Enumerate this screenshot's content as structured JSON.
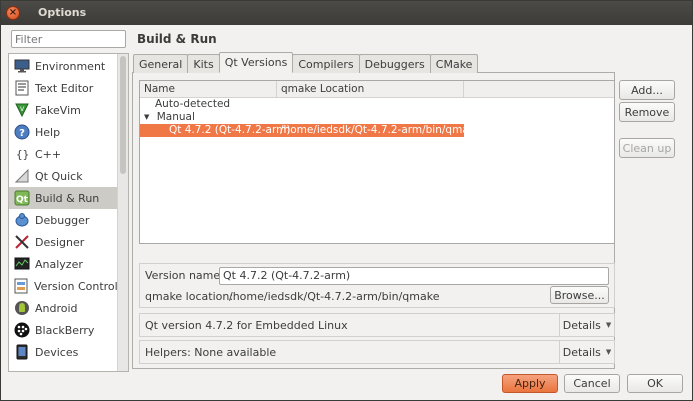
{
  "window": {
    "title": "Options",
    "close_glyph": "×"
  },
  "filter": {
    "placeholder": "Filter",
    "value": ""
  },
  "sidebar": {
    "items": [
      {
        "label": "Environment",
        "icon": "monitor-icon",
        "selected": false
      },
      {
        "label": "Text Editor",
        "icon": "text-editor-icon",
        "selected": false
      },
      {
        "label": "FakeVim",
        "icon": "fakevim-icon",
        "selected": false
      },
      {
        "label": "Help",
        "icon": "help-icon",
        "selected": false
      },
      {
        "label": "C++",
        "icon": "cpp-icon",
        "selected": false
      },
      {
        "label": "Qt Quick",
        "icon": "qt-quick-icon",
        "selected": false
      },
      {
        "label": "Build & Run",
        "icon": "build-run-icon",
        "selected": true
      },
      {
        "label": "Debugger",
        "icon": "debugger-icon",
        "selected": false
      },
      {
        "label": "Designer",
        "icon": "designer-icon",
        "selected": false
      },
      {
        "label": "Analyzer",
        "icon": "analyzer-icon",
        "selected": false
      },
      {
        "label": "Version Control",
        "icon": "version-control-icon",
        "selected": false
      },
      {
        "label": "Android",
        "icon": "android-icon",
        "selected": false
      },
      {
        "label": "BlackBerry",
        "icon": "blackberry-icon",
        "selected": false
      },
      {
        "label": "Devices",
        "icon": "devices-icon",
        "selected": false
      }
    ]
  },
  "page": {
    "title": "Build & Run"
  },
  "tabs": [
    {
      "label": "General",
      "active": false
    },
    {
      "label": "Kits",
      "active": false
    },
    {
      "label": "Qt Versions",
      "active": true
    },
    {
      "label": "Compilers",
      "active": false
    },
    {
      "label": "Debuggers",
      "active": false
    },
    {
      "label": "CMake",
      "active": false
    }
  ],
  "table": {
    "columns": [
      "Name",
      "qmake Location"
    ],
    "rows": [
      {
        "name": "Auto-detected",
        "location": "",
        "level": 0,
        "expander": ""
      },
      {
        "name": "Manual",
        "location": "",
        "level": 0,
        "expander": "▼"
      },
      {
        "name": "Qt 4.7.2 (Qt-4.7.2-arm)",
        "location": "/home/iedsdk/Qt-4.7.2-arm/bin/qmake",
        "level": 1,
        "expander": "",
        "selected": true
      }
    ]
  },
  "buttons": {
    "add": "Add...",
    "remove": "Remove",
    "cleanup": "Clean up"
  },
  "details": {
    "version_name_label": "Version name:",
    "version_name_value": "Qt 4.7.2 (Qt-4.7.2-arm)",
    "qmake_location_label": "qmake location:",
    "qmake_location_value": "/home/iedsdk/Qt-4.7.2-arm/bin/qmake",
    "browse": "Browse..."
  },
  "info_rows": [
    {
      "text": "Qt version 4.7.2 for Embedded Linux",
      "details": "Details"
    },
    {
      "text": "Helpers: None available",
      "details": "Details"
    }
  ],
  "footer": {
    "apply": "Apply",
    "cancel": "Cancel",
    "ok": "OK"
  },
  "colors": {
    "accent": "#f07746",
    "selected_sidebar": "#cdcbc6",
    "titlebar": "#3c3b37"
  }
}
